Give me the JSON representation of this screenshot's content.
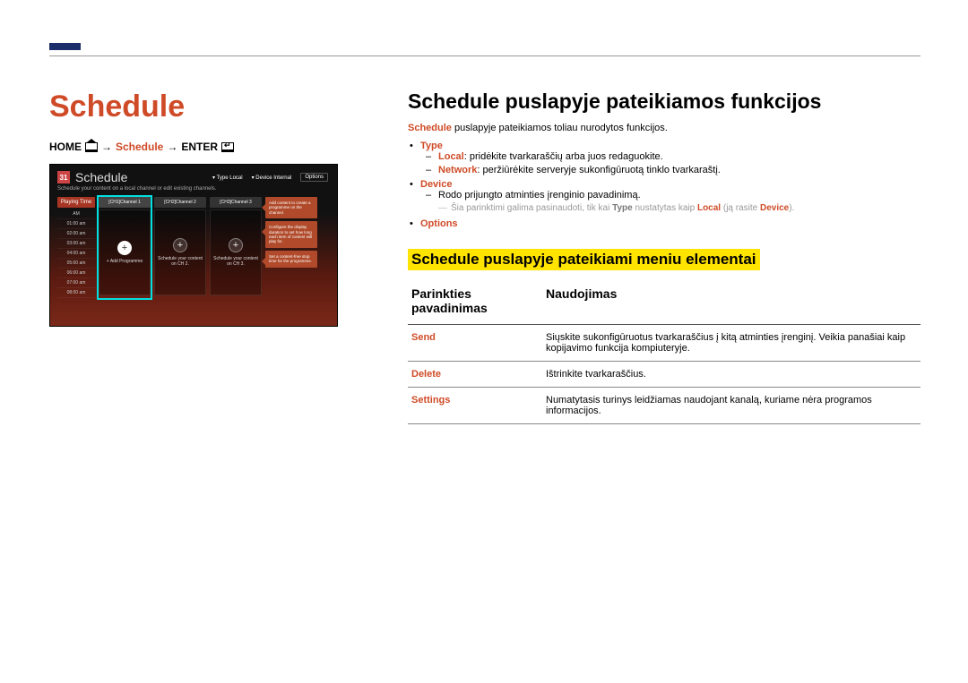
{
  "left": {
    "title": "Schedule",
    "breadcrumb": {
      "home": "HOME",
      "schedule": "Schedule",
      "enter": "ENTER",
      "arrow": "→"
    },
    "app": {
      "icon_day": "31",
      "title": "Schedule",
      "top_type_label": "Type",
      "top_type_value": "Local",
      "top_device_label": "Device",
      "top_device_value": "Internal",
      "top_options": "Options",
      "subtitle": "Schedule your content on a local channel or edit existing channels.",
      "time_head": "Playing Time",
      "times": [
        "AM",
        "01:00 am",
        "02:00 am",
        "03:00 am",
        "04:00 am",
        "05:00 am",
        "06:00 am",
        "07:00 am",
        "08:00 am"
      ],
      "channels": [
        {
          "head": "[CH1]Channel 1",
          "label": "+ Add Programme",
          "selected": true
        },
        {
          "head": "[CH2]Channel 2",
          "label": "Schedule your content on CH 2.",
          "selected": false
        },
        {
          "head": "[CH3]Channel 3",
          "label": "Schedule your content on CH 3.",
          "selected": false
        }
      ],
      "hints": [
        "Add content to create a programme on the channel.",
        "Configure the display duration to set how long each item of content will play for.",
        "Set a content-free stop time for the programme."
      ]
    }
  },
  "right": {
    "h2": "Schedule puslapyje pateikiamos funkcijos",
    "intro_prefix": "Schedule",
    "intro_rest": " puslapyje pateikiamos toliau nurodytos funkcijos.",
    "type_label": "Type",
    "type_local_k": "Local",
    "type_local_v": ": pridėkite tvarkaraščių arba juos redaguokite.",
    "type_net_k": "Network",
    "type_net_v": ": peržiūrėkite serveryje sukonfigūruotą tinklo tvarkaraštį.",
    "device_label": "Device",
    "device_desc": "Rodo prijungto atminties įrenginio pavadinimą.",
    "device_note_a": "Šia parinktimi galima pasinaudoti, tik kai ",
    "device_note_type": "Type",
    "device_note_b": " nustatytas kaip ",
    "device_note_local": "Local",
    "device_note_c": " (ją rasite ",
    "device_note_device": "Device",
    "device_note_d": ").",
    "options_label": "Options",
    "h3": "Schedule puslapyje pateikiami meniu elementai",
    "table": {
      "th1": "Parinkties pavadinimas",
      "th2": "Naudojimas",
      "rows": [
        {
          "name": "Send",
          "desc": "Siųskite sukonfigūruotus tvarkaraščius į kitą atminties įrenginį. Veikia panašiai kaip kopijavimo funkcija kompiuteryje."
        },
        {
          "name": "Delete",
          "desc": "Ištrinkite tvarkaraščius."
        },
        {
          "name": "Settings",
          "desc": "Numatytasis turinys leidžiamas naudojant kanalą, kuriame nėra programos informacijos."
        }
      ]
    }
  }
}
